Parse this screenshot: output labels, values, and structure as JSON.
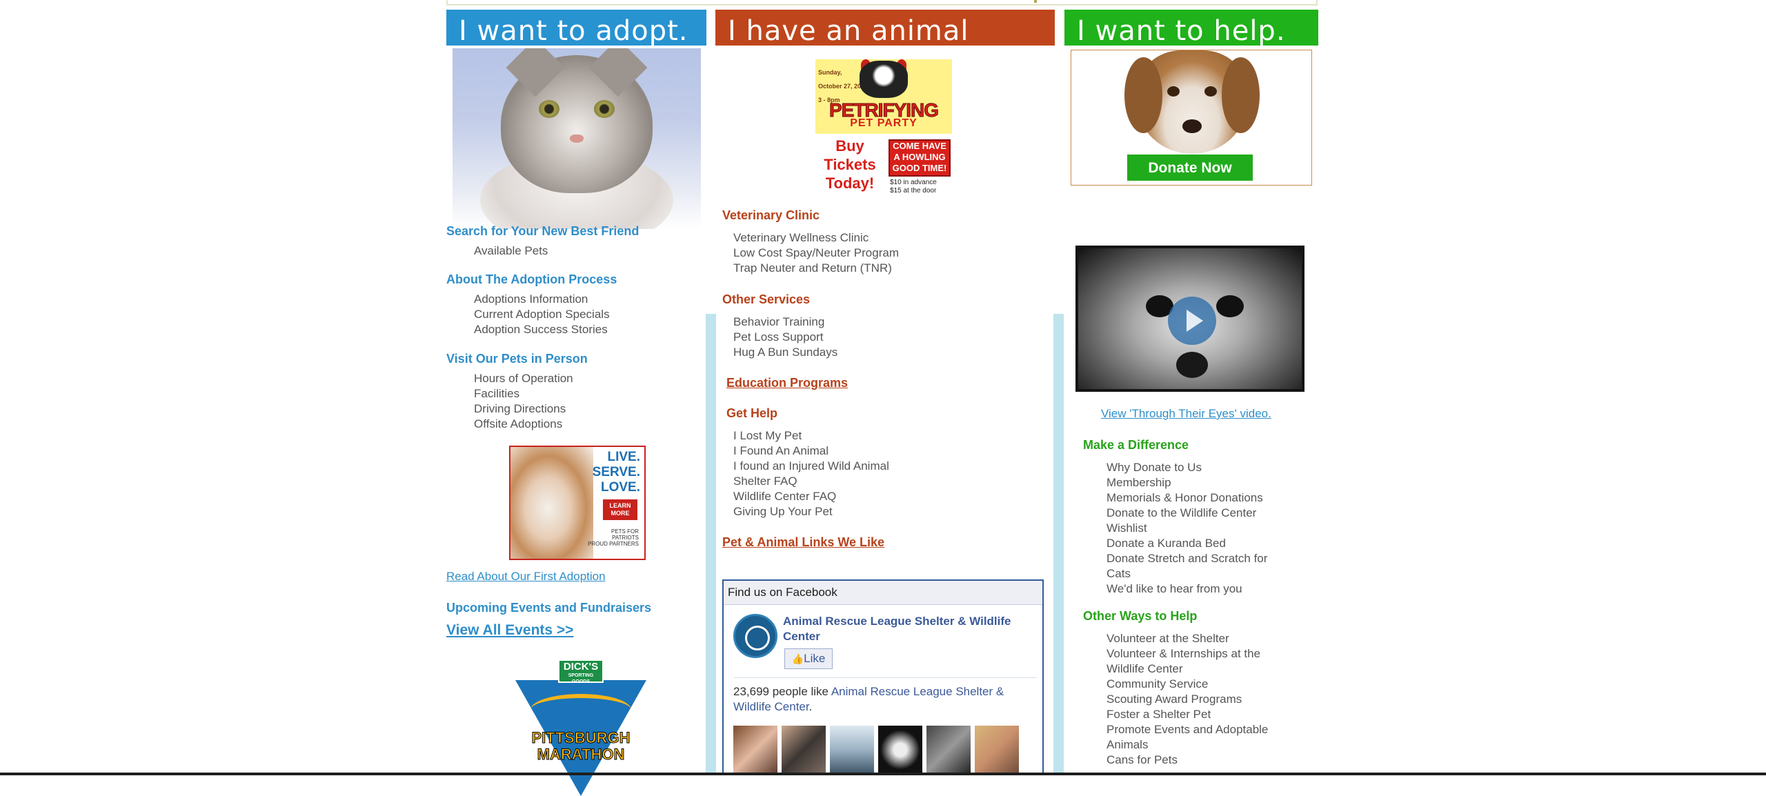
{
  "headers": {
    "adopt": "I want to adopt.",
    "animal": "I have an animal",
    "help": "I want to help."
  },
  "adopt": {
    "sections": [
      {
        "title": "Search for Your New Best Friend",
        "items": [
          "Available Pets"
        ]
      },
      {
        "title": "About The Adoption Process",
        "items": [
          "Adoptions Information",
          "Current Adoption Specials",
          "Adoption Success Stories"
        ]
      },
      {
        "title": "Visit Our Pets in Person",
        "items": [
          "Hours of Operation",
          "Facilities",
          "Driving Directions",
          "Offsite Adoptions"
        ]
      }
    ],
    "ad": {
      "lines": [
        "LIVE.",
        "SERVE.",
        "LOVE."
      ],
      "button": [
        "LEARN",
        "MORE"
      ],
      "logo": [
        "PETS FOR",
        "PATRIOTS",
        "PROUD PARTNERS"
      ]
    },
    "first_adoption_link": "Read About Our First Adoption",
    "events_title": "Upcoming Events and Fundraisers",
    "view_all_events": "View All Events >>",
    "marathon": {
      "badge": "DICK'S",
      "badge_sub": "SPORTING GOODS",
      "lines": [
        "PITTSBURGH",
        "MARATHON"
      ]
    }
  },
  "animal": {
    "party_ad": {
      "date": [
        "Sunday,",
        "October 27, 2013",
        "3 - 8pm"
      ],
      "title": "PETRIFYING",
      "subtitle": "PET PARTY",
      "buy": [
        "Buy",
        "Tickets",
        "Today!"
      ],
      "box": "Come have a howling good time!",
      "price": [
        "$10 in advance",
        "$15 at the door"
      ]
    },
    "vet_title": "Veterinary Clinic",
    "vet_items": [
      "Veterinary Wellness Clinic",
      "Low Cost Spay/Neuter Program",
      "Trap Neuter and Return (TNR)"
    ],
    "other_title": "Other Services",
    "other_items": [
      "Behavior Training",
      "Pet Loss Support",
      "Hug A Bun Sundays"
    ],
    "education": "Education Programs",
    "gethelp_title": "Get Help",
    "gethelp_items": [
      "I Lost My Pet",
      "I Found An Animal",
      "I found an Injured Wild Animal",
      "Shelter FAQ",
      "Wildlife Center FAQ",
      "Giving Up Your Pet"
    ],
    "links_title": "Pet & Animal Links We Like",
    "facebook": {
      "header": "Find us on Facebook",
      "page_name": "Animal Rescue League Shelter & Wildlife Center",
      "like": "Like",
      "count_text": "23,699 people like",
      "count_link": "Animal Rescue League Shelter & Wildlife Center",
      "count_end": "."
    }
  },
  "help": {
    "donate_button": "Donate Now",
    "video_link": "View 'Through Their Eyes' video.",
    "difference_title": "Make a Difference",
    "difference_items": [
      "Why Donate to Us",
      "Membership",
      "Memorials & Honor Donations",
      "Donate to the Wildlife Center Wishlist",
      "Donate a Kuranda Bed",
      "Donate Stretch and Scratch for Cats",
      "We'd like to hear from you"
    ],
    "ways_title": "Other Ways to Help",
    "ways_items": [
      "Volunteer at the Shelter",
      "Volunteer & Internships at the Wildlife Center",
      "Community Service",
      "Scouting Award Programs",
      "Foster a Shelter Pet",
      "Promote Events and Adoptable Animals",
      "Cans for Pets"
    ]
  },
  "colors": {
    "adopt": "#2893d1",
    "animal": "#bf461c",
    "help": "#1fb21a",
    "facebook": "#3b5998"
  }
}
